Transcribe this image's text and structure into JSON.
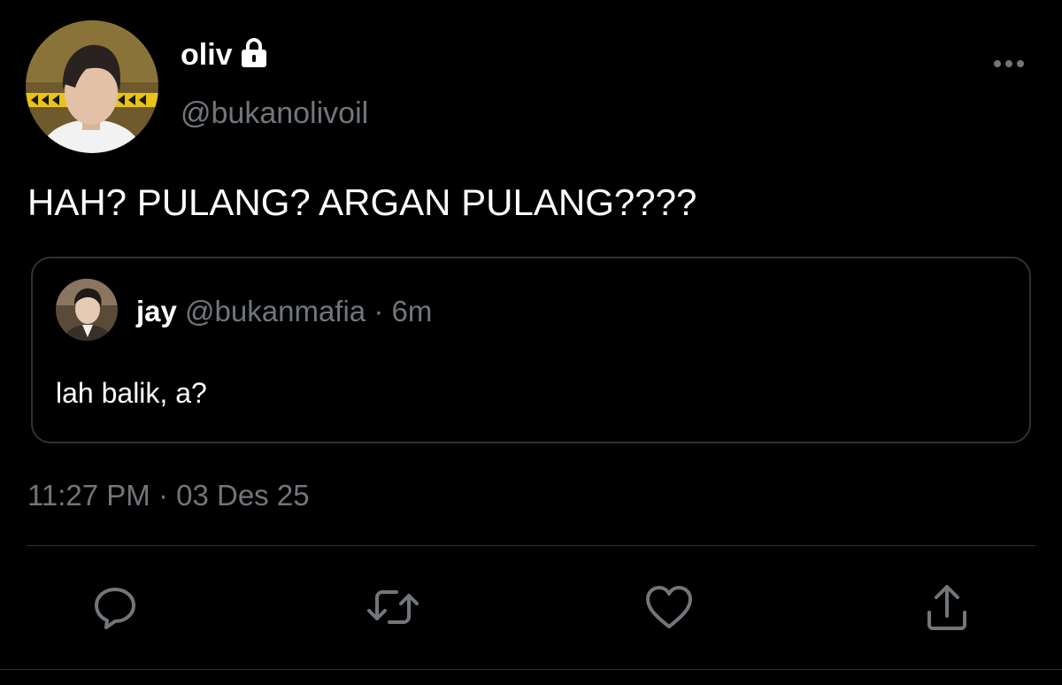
{
  "author": {
    "display_name": "oliv",
    "handle": "@bukanolivoil",
    "protected_icon": "lock-icon",
    "avatar_icon": "user-avatar"
  },
  "tweet": {
    "text": "HAH? PULANG? ARGAN PULANG????",
    "timestamp": "11:27 PM · 03 Des 25"
  },
  "quoted_tweet": {
    "display_name": "jay",
    "meta": "@bukanmafia · 6m",
    "text": "lah balik, a?"
  },
  "actions": {
    "reply_icon": "reply-icon",
    "retweet_icon": "retweet-icon",
    "like_icon": "heart-icon",
    "share_icon": "share-icon",
    "more_icon": "more-options-icon"
  },
  "colors": {
    "background": "#000000",
    "primary_text": "#ffffff",
    "secondary_text": "#71767b",
    "border": "#2f3336"
  }
}
